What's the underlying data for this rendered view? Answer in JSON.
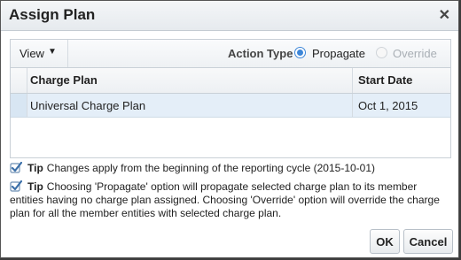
{
  "dialog": {
    "title": "Assign Plan",
    "close_glyph": "✕"
  },
  "toolbar": {
    "view_label": "View",
    "view_caret": "▼",
    "action_type_label": "Action Type",
    "options": [
      {
        "label": "Propagate",
        "selected": true,
        "enabled": true
      },
      {
        "label": "Override",
        "selected": false,
        "enabled": false
      }
    ]
  },
  "table": {
    "columns": [
      "Charge Plan",
      "Start Date"
    ],
    "rows": [
      {
        "charge_plan": "Universal Charge Plan",
        "start_date": "Oct 1, 2015",
        "selected": true
      }
    ]
  },
  "tips": [
    {
      "label": "Tip",
      "text": "Changes apply from the beginning of the reporting cycle (2015-10-01)",
      "icon": "checkmark-icon"
    },
    {
      "label": "Tip",
      "text_first": "Choosing 'Propagate' option will propagate selected charge plan to its member",
      "text_rest": "entities having no charge plan assigned. Choosing 'Override' option will override the charge plan for all the member entities with selected charge plan.",
      "icon": "checkmark-icon"
    }
  ],
  "buttons": {
    "ok": "OK",
    "cancel": "Cancel"
  },
  "colors": {
    "accent": "#3d86d8",
    "selected_row": "#e4eef8",
    "check": "#3b6fa8"
  }
}
